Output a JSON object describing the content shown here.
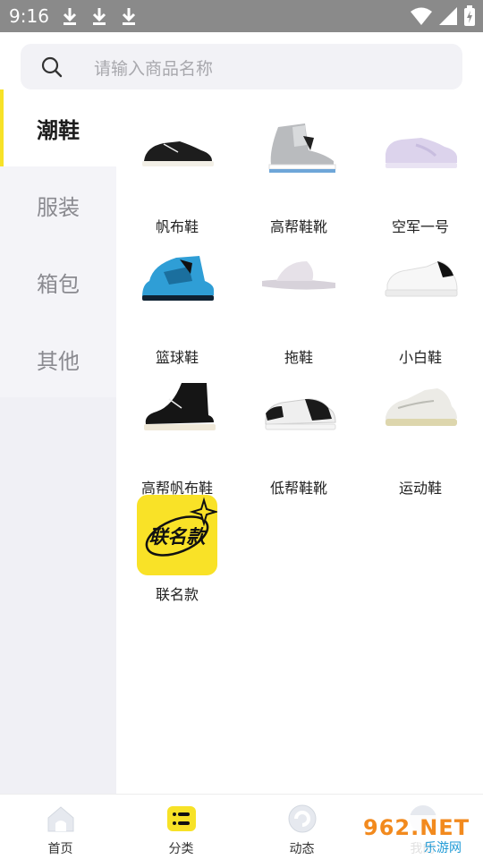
{
  "status_bar": {
    "time": "9:16"
  },
  "search": {
    "placeholder": "请输入商品名称"
  },
  "sidebar": {
    "items": [
      {
        "label": "潮鞋",
        "active": true
      },
      {
        "label": "服装",
        "active": false
      },
      {
        "label": "箱包",
        "active": false
      },
      {
        "label": "其他",
        "active": false
      }
    ]
  },
  "products": [
    {
      "name": "帆布鞋",
      "icon": "low-top-canvas-shoe"
    },
    {
      "name": "高帮鞋靴",
      "icon": "high-top-sneaker"
    },
    {
      "name": "空军一号",
      "icon": "air-force-one-shoe"
    },
    {
      "name": "篮球鞋",
      "icon": "basketball-shoe"
    },
    {
      "name": "拖鞋",
      "icon": "slide-slipper"
    },
    {
      "name": "小白鞋",
      "icon": "white-sneaker"
    },
    {
      "name": "高帮帆布鞋",
      "icon": "high-top-canvas-shoe"
    },
    {
      "name": "低帮鞋靴",
      "icon": "low-top-sneaker"
    },
    {
      "name": "运动鞋",
      "icon": "running-shoe"
    },
    {
      "name": "联名款",
      "icon": "collab-badge",
      "badge_text": "联名款"
    }
  ],
  "bottom_nav": [
    {
      "label": "首页",
      "icon": "home-icon"
    },
    {
      "label": "分类",
      "icon": "category-icon",
      "active": true
    },
    {
      "label": "动态",
      "icon": "feed-icon"
    },
    {
      "label": "我的",
      "icon": "profile-icon"
    }
  ],
  "watermark": {
    "text": "962.NET",
    "sub": "乐游网"
  },
  "colors": {
    "accent": "#f7e227",
    "sidebar_bg": "#f4f4f8",
    "statusbar_bg": "#8a8a8a"
  }
}
